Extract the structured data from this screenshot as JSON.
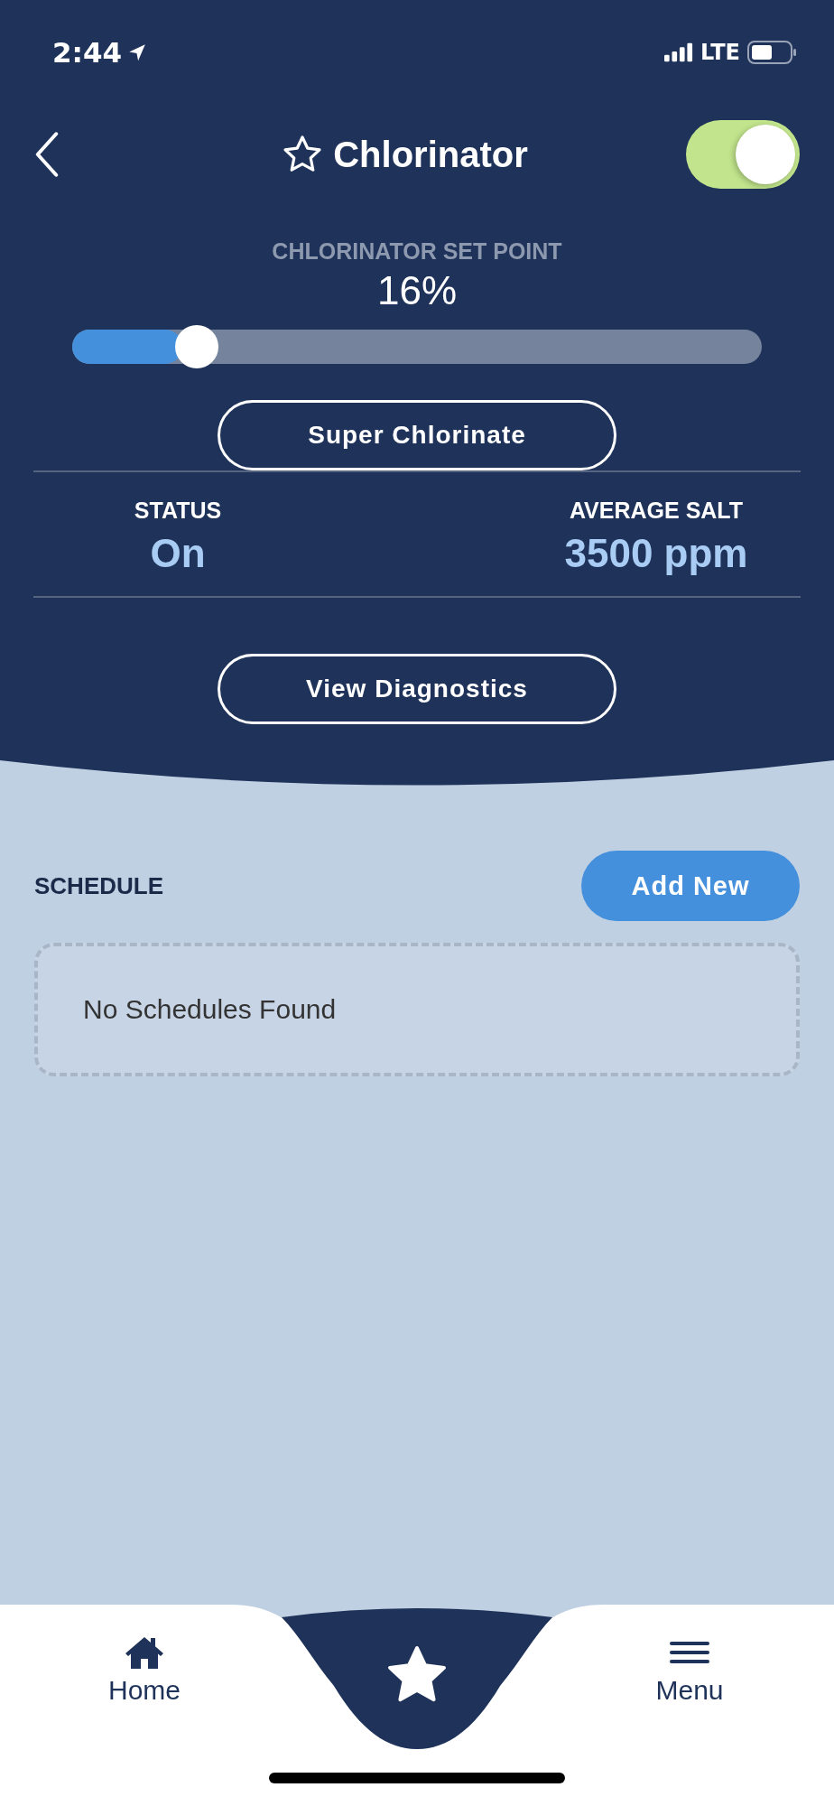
{
  "status_bar": {
    "time": "2:44",
    "network": "LTE"
  },
  "header": {
    "title": "Chlorinator",
    "power_on": true
  },
  "set_point": {
    "label": "CHLORINATOR SET POINT",
    "reading": "16%",
    "level": 0.16
  },
  "super_chlorinate_button": "Super Chlorinate",
  "stats": [
    {
      "label": "STATUS",
      "value": "On"
    },
    {
      "label": "AVERAGE SALT",
      "value": "3500 ppm"
    }
  ],
  "diagnostics_button": "View Diagnostics",
  "schedule": {
    "title": "SCHEDULE",
    "add_button": "Add New",
    "empty_message": "No Schedules Found"
  },
  "nav": [
    {
      "kind": "home",
      "label": "Home"
    },
    {
      "kind": "favorites"
    },
    {
      "kind": "menu",
      "label": "Menu"
    }
  ]
}
